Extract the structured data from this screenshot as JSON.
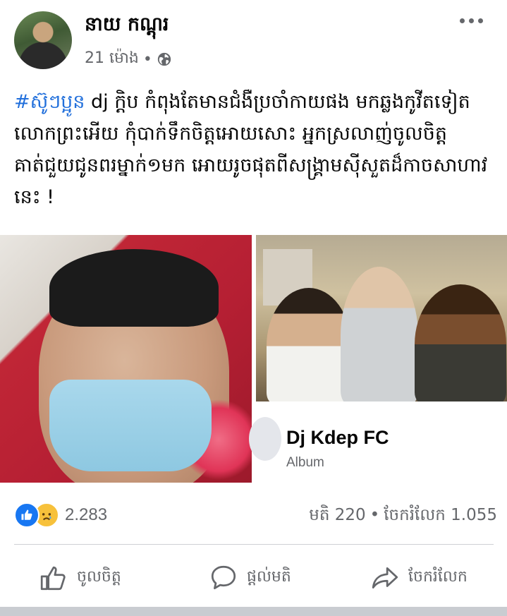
{
  "post": {
    "author": "នាយ កណ្តុរ",
    "time": "21 ម៉ោង",
    "separator": "•",
    "privacy_icon": "globe-icon",
    "more_icon": "more-dots-icon",
    "hashtag": "#ស៊ូៗប្អូន",
    "text": " dj ក្តិប កំពុងតែមានជំងឺប្រចាំកាយផង មកឆ្លងកូវីតទៀតលោកព្រះអើយ កុំបាក់ទឹកចិត្តអោយសោះ អ្នកស្រលាញ់ចូលចិត្តគាត់ជួយជូនពរម្នាក់១មក អោយរូចផុតពីសង្គ្រាមស៊ីសួតដ៏កាចសាហាវនេះ !"
  },
  "album": {
    "title": "Dj Kdep FC",
    "subtitle": "Album"
  },
  "stats": {
    "reactions_count": "2.283",
    "comments": "មតិ 220",
    "shares": "ចែករំលែក 1.055",
    "dot": "•"
  },
  "actions": {
    "like": "ចូលចិត្ត",
    "comment": "ផ្តល់មតិ",
    "share": "ចែករំលែក"
  },
  "colors": {
    "hashtag": "#216fdb",
    "like_blue": "#1877f2",
    "sad_yellow": "#f7c13b",
    "secondary_text": "#65676b"
  }
}
